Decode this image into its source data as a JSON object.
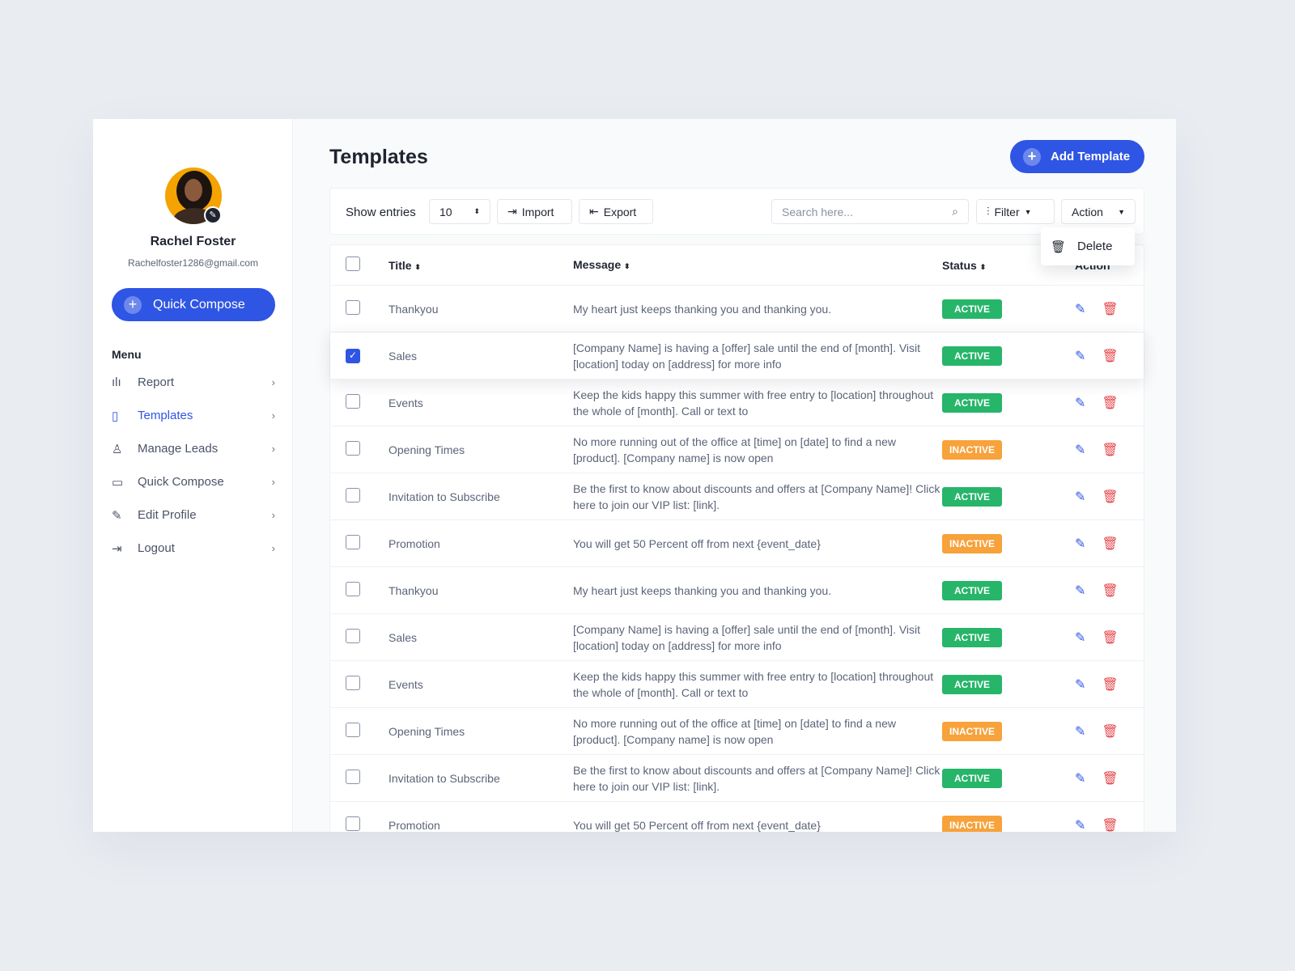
{
  "user": {
    "name": "Rachel Foster",
    "email": "Rachelfoster1286@gmail.com"
  },
  "sidebar": {
    "quick_compose": "Quick Compose",
    "menu_heading": "Menu",
    "items": [
      {
        "label": "Report",
        "icon": "bar-chart-icon"
      },
      {
        "label": "Templates",
        "icon": "tablet-icon",
        "active": true
      },
      {
        "label": "Manage Leads",
        "icon": "user-icon"
      },
      {
        "label": "Quick Compose",
        "icon": "message-icon"
      },
      {
        "label": "Edit Profile",
        "icon": "pen-icon"
      },
      {
        "label": "Logout",
        "icon": "logout-icon"
      }
    ]
  },
  "page": {
    "title": "Templates",
    "add_label": "Add Template"
  },
  "toolbar": {
    "show_entries": "Show entries",
    "entries_value": "10",
    "import": "Import",
    "export": "Export",
    "search_placeholder": "Search here...",
    "filter": "Filter",
    "action": "Action"
  },
  "dropdown": {
    "delete": "Delete"
  },
  "table": {
    "headers": {
      "title": "Title",
      "message": "Message",
      "status": "Status",
      "action": "Action"
    },
    "rows": [
      {
        "title": "Thankyou",
        "message": "My heart just keeps thanking you and thanking you.",
        "status": "ACTIVE",
        "checked": false
      },
      {
        "title": "Sales",
        "message": "[Company Name] is having a [offer] sale until the end of [month]. Visit [location] today on [address] for more info",
        "status": "ACTIVE",
        "checked": true
      },
      {
        "title": "Events",
        "message": "Keep the kids happy this summer with free entry to [location] throughout the whole of [month]. Call or text to",
        "status": "ACTIVE",
        "checked": false
      },
      {
        "title": "Opening Times",
        "message": "No more running out of the office at [time] on [date] to find a new [product]. [Company name] is now open",
        "status": "INACTIVE",
        "checked": false
      },
      {
        "title": "Invitation to Subscribe",
        "message": "Be the first to know about discounts and offers at [Company Name]! Click here to join our VIP list: [link].",
        "status": "ACTIVE",
        "checked": false
      },
      {
        "title": "Promotion",
        "message": "You will get 50 Percent off from next {event_date}",
        "status": "INACTIVE",
        "checked": false
      },
      {
        "title": "Thankyou",
        "message": "My heart just keeps thanking you and thanking you.",
        "status": "ACTIVE",
        "checked": false
      },
      {
        "title": "Sales",
        "message": "[Company Name] is having a [offer] sale until the end of [month]. Visit [location] today on [address] for more info",
        "status": "ACTIVE",
        "checked": false
      },
      {
        "title": "Events",
        "message": "Keep the kids happy this summer with free entry to [location] throughout the whole of [month]. Call or text to",
        "status": "ACTIVE",
        "checked": false
      },
      {
        "title": "Opening Times",
        "message": "No more running out of the office at [time] on [date] to find a new [product]. [Company name] is now open",
        "status": "INACTIVE",
        "checked": false
      },
      {
        "title": "Invitation to Subscribe",
        "message": "Be the first to know about discounts and offers at [Company Name]! Click here to join our VIP list: [link].",
        "status": "ACTIVE",
        "checked": false
      },
      {
        "title": "Promotion",
        "message": "You will get 50 Percent off from next {event_date}",
        "status": "INACTIVE",
        "checked": false
      }
    ]
  },
  "colors": {
    "accent": "#2f55e4",
    "active": "#27b56a",
    "inactive": "#f7a23b",
    "delete": "#e5484d"
  }
}
